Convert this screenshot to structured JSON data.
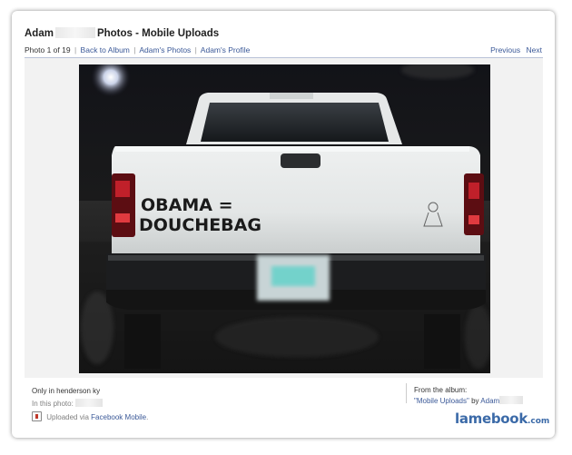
{
  "header": {
    "title_prefix": "Adam",
    "title_suffix": "Photos - Mobile Uploads"
  },
  "nav": {
    "photo_counter": "Photo 1 of 19",
    "back_to_album": "Back to Album",
    "owner_photos": "Adam's Photos",
    "owner_profile": "Adam's Profile",
    "previous": "Previous",
    "next": "Next",
    "separator": "|"
  },
  "photo": {
    "sticker_line1": "OBAMA =",
    "sticker_line2": "DOUCHEBAG"
  },
  "caption": {
    "text": "Only in henderson ky",
    "in_photo_label": "In this photo:",
    "uploaded_prefix": "Uploaded via",
    "uploaded_link": "Facebook Mobile",
    "uploaded_suffix": "."
  },
  "album": {
    "from_label": "From the album:",
    "album_link": "\"Mobile Uploads\"",
    "by_label": "by",
    "owner_link": "Adam"
  },
  "watermark": {
    "name": "lamebook",
    "domain": ".com"
  },
  "colors": {
    "link": "#3b5998",
    "watermark": "#3b6aa8",
    "stage_bg": "#f2f2f2"
  }
}
